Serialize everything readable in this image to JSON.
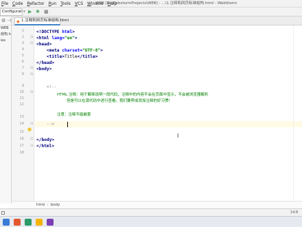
{
  "menu": [
    "File",
    "Code",
    "Refactor",
    "Run",
    "Tools",
    "VCS",
    "Window",
    "Help"
  ],
  "window_title": "WEB [D:\\WebstormProjects\\WEB] - ...\\1.注释和网页标准结构.html - WebStorm",
  "toolbar": {
    "run_config_label": "Configuration...",
    "icons": [
      "run-icon",
      "debug-icon",
      "vcs-icon"
    ]
  },
  "project_pane": {
    "items": [
      "WEB",
      "结构.html",
      "ies"
    ]
  },
  "tab": {
    "label": "1.注释和网页标准结构.html",
    "close_glyph": "×"
  },
  "editor": {
    "line_numbers": [
      "1",
      "2",
      "3",
      "4",
      "5",
      "6",
      "7",
      "8",
      "9",
      "10",
      "11",
      "12",
      "13",
      "14",
      "15",
      "16",
      "17",
      "18"
    ],
    "lines": {
      "l1a": "<!DOCTYPE ",
      "l1b": "html",
      "l1c": ">",
      "l2a": "<html ",
      "l2b": "lang=",
      "l2c": "\"en\"",
      "l2d": ">",
      "l3": "<head>",
      "l4a": "    <meta ",
      "l4b": "charset=",
      "l4c": "\"UTF-8\"",
      "l4d": ">",
      "l5a": "    <title>",
      "l5b": "Title",
      "l5c": "</title>",
      "l6": "</head>",
      "l7": "<body>",
      "l9": "    <!--",
      "l10": "HTML 注释：用于解释说明一段代码，注释中的内容不会在页面中显示，不会被浏览器解析",
      "l11": "但是可以在源代码中进行查看。我们要养成添加注释的好习惯！",
      "l13": "注意：注释不能嵌套",
      "l14": "    -->",
      "l16": "</body>",
      "l17": "</html>"
    }
  },
  "breadcrumbs": [
    "html",
    "body"
  ],
  "breadcrumb_separator": "›",
  "status": {
    "position": "14:8"
  },
  "colors": {
    "tag": "#000080",
    "attribute": "#0000ff",
    "value": "#008000",
    "comment": "#808080",
    "comment_text": "#008000",
    "current_line": "#fffae3"
  }
}
